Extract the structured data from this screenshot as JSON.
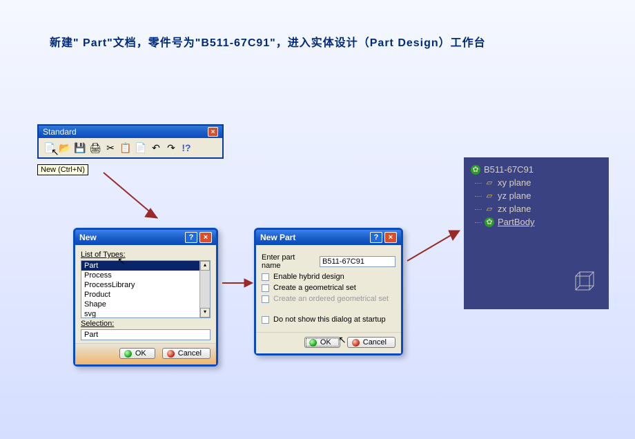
{
  "instruction": "新建\" Part\"文档，零件号为\"B511-67C91\"，进入实体设计（Part Design）工作台",
  "standard": {
    "title": "Standard",
    "tooltip": "New (Ctrl+N)"
  },
  "newDialog": {
    "title": "New",
    "listLabel": "List of Types:",
    "items": [
      "Part",
      "Process",
      "ProcessLibrary",
      "Product",
      "Shape",
      "svg"
    ],
    "selLabel": "Selection:",
    "selection": "Part",
    "ok": "OK",
    "cancel": "Cancel"
  },
  "newPart": {
    "title": "New Part",
    "nameLabel": "Enter part name",
    "nameValue": "B511-67C91",
    "opts": {
      "hybrid": "Enable hybrid design",
      "geoset": "Create a geometrical set",
      "ordered": "Create an ordered geometrical set",
      "noShow": "Do not show this dialog at startup"
    },
    "ok": "OK",
    "cancel": "Cancel"
  },
  "tree": {
    "root": "B511-67C91",
    "planes": [
      "xy plane",
      "yz plane",
      "zx plane"
    ],
    "body": "PartBody"
  }
}
